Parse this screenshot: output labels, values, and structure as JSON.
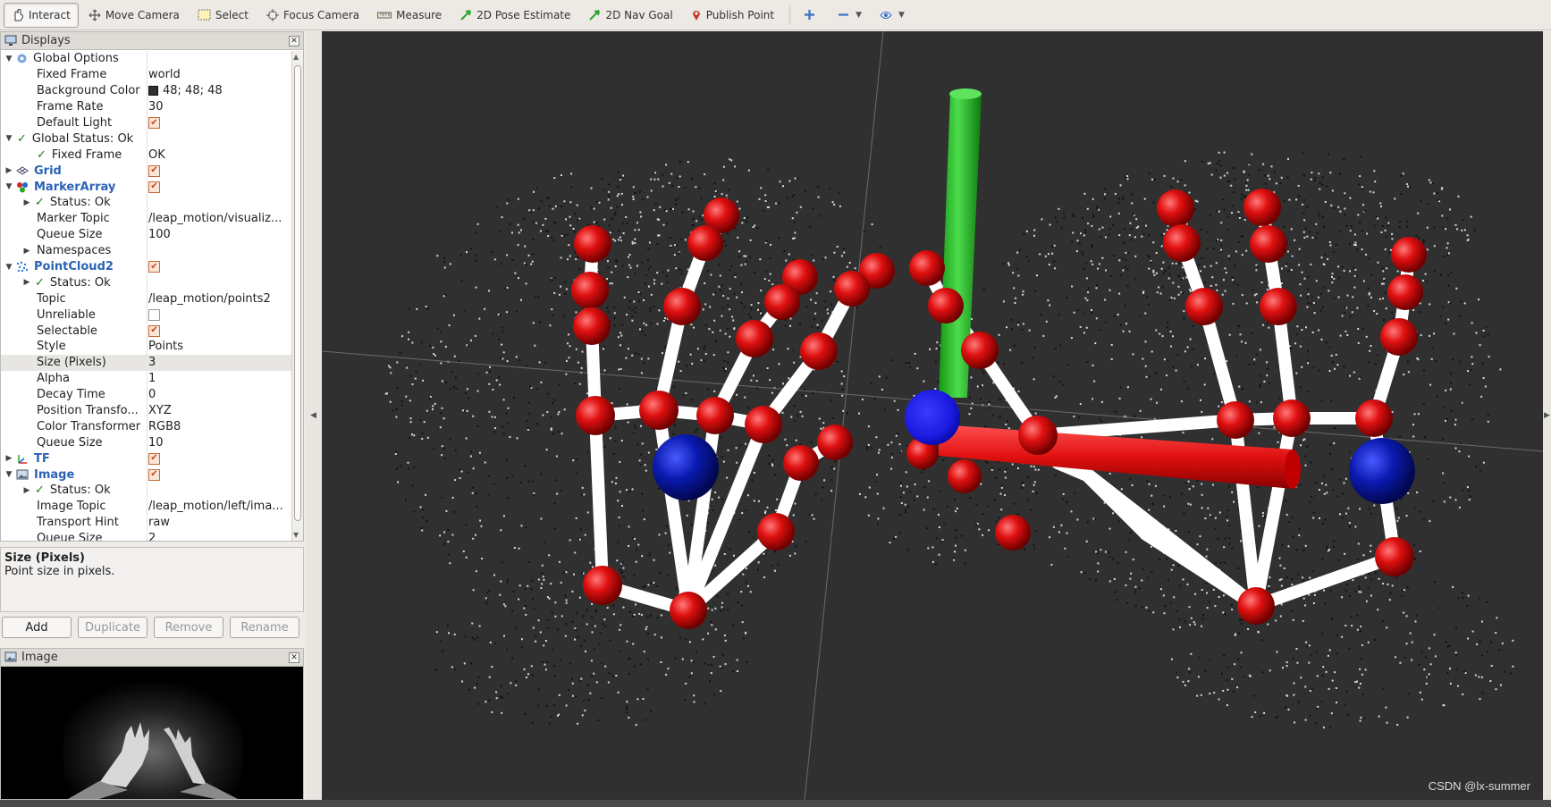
{
  "toolbar": {
    "interact": "Interact",
    "move_camera": "Move Camera",
    "select": "Select",
    "focus_camera": "Focus Camera",
    "measure": "Measure",
    "pose_estimate": "2D Pose Estimate",
    "nav_goal": "2D Nav Goal",
    "publish_point": "Publish Point"
  },
  "displays": {
    "title": "Displays",
    "rows": [
      {
        "name": "Global Options",
        "value": ""
      },
      {
        "name": "Fixed Frame",
        "value": "world"
      },
      {
        "name": "Background Color",
        "value": "48; 48; 48"
      },
      {
        "name": "Frame Rate",
        "value": "30"
      },
      {
        "name": "Default Light",
        "value": ""
      },
      {
        "name": "Global Status: Ok",
        "value": ""
      },
      {
        "name": "Fixed Frame",
        "value": "OK"
      },
      {
        "name": "Grid",
        "value": ""
      },
      {
        "name": "MarkerArray",
        "value": ""
      },
      {
        "name": "Status: Ok",
        "value": ""
      },
      {
        "name": "Marker Topic",
        "value": "/leap_motion/visualiz..."
      },
      {
        "name": "Queue Size",
        "value": "100"
      },
      {
        "name": "Namespaces",
        "value": ""
      },
      {
        "name": "PointCloud2",
        "value": ""
      },
      {
        "name": "Status: Ok",
        "value": ""
      },
      {
        "name": "Topic",
        "value": "/leap_motion/points2"
      },
      {
        "name": "Unreliable",
        "value": ""
      },
      {
        "name": "Selectable",
        "value": ""
      },
      {
        "name": "Style",
        "value": "Points"
      },
      {
        "name": "Size (Pixels)",
        "value": "3"
      },
      {
        "name": "Alpha",
        "value": "1"
      },
      {
        "name": "Decay Time",
        "value": "0"
      },
      {
        "name": "Position Transfo...",
        "value": "XYZ"
      },
      {
        "name": "Color Transformer",
        "value": "RGB8"
      },
      {
        "name": "Queue Size",
        "value": "10"
      },
      {
        "name": "TF",
        "value": ""
      },
      {
        "name": "Image",
        "value": ""
      },
      {
        "name": "Status: Ok",
        "value": ""
      },
      {
        "name": "Image Topic",
        "value": "/leap_motion/left/ima..."
      },
      {
        "name": "Transport Hint",
        "value": "raw"
      },
      {
        "name": "Queue Size",
        "value": "2"
      }
    ]
  },
  "description": {
    "title": "Size (Pixels)",
    "text": "Point size in pixels."
  },
  "buttons": {
    "add": "Add",
    "duplicate": "Duplicate",
    "remove": "Remove",
    "rename": "Rename"
  },
  "image_panel": {
    "title": "Image"
  },
  "watermark": "CSDN @lx-summer",
  "colors": {
    "background": "#303030",
    "joint": "#e01010",
    "bone": "#ffffff",
    "palm": "#0a1ab0",
    "axis_x": "#e01010",
    "axis_y": "#22c322",
    "axis_z": "#1a1ae0"
  }
}
